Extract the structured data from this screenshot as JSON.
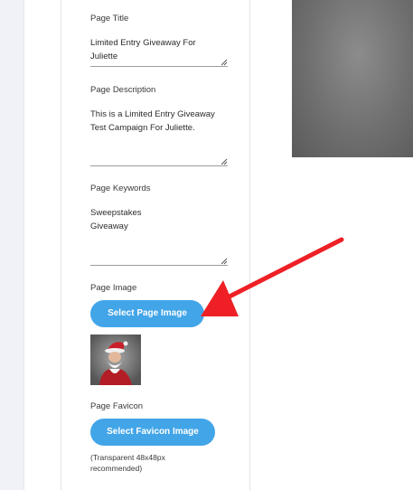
{
  "form": {
    "page_title": {
      "label": "Page Title",
      "value": "Limited Entry Giveaway For\nJuliette"
    },
    "page_description": {
      "label": "Page Description",
      "value": "This is a Limited Entry Giveaway\nTest Campaign For Juliette."
    },
    "page_keywords": {
      "label": "Page Keywords",
      "value": "Sweepstakes\nGiveaway"
    },
    "page_image": {
      "label": "Page Image",
      "button_label": "Select Page Image"
    },
    "page_favicon": {
      "label": "Page Favicon",
      "button_label": "Select Favicon Image",
      "help_text": "(Transparent 48x48px recommended)"
    }
  },
  "colors": {
    "button": "#42a5e8",
    "annotation_arrow": "#ee2026"
  },
  "icons": {
    "resize_grip": "resize-grip-icon",
    "annotation": "red-arrow-annotation"
  }
}
